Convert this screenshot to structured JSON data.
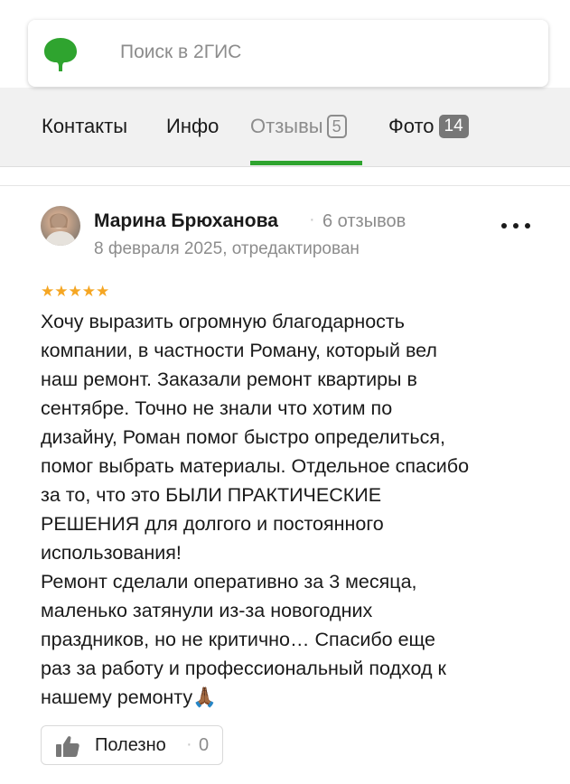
{
  "search": {
    "placeholder": "Поиск в 2ГИС",
    "logo_icon": "2gis-leaf-logo",
    "logo_color": "#2fa42f"
  },
  "tabs": [
    {
      "label": "Контакты",
      "active": false
    },
    {
      "label": "Инфо",
      "active": false
    },
    {
      "label": "Отзывы",
      "badge": "5",
      "active": true
    },
    {
      "label": "Фото",
      "badge": "14",
      "active": false
    }
  ],
  "accent_color": "#2fa42f",
  "review": {
    "author": "Марина Брюханова",
    "separator": "·",
    "author_review_count": "6 отзывов",
    "date": "8 февраля 2025, отредактирован",
    "rating": 5,
    "stars": "★★★★★",
    "text": "Хочу выразить огромную благодарность\nкомпании, в частности Роману, который вел\nнаш ремонт. Заказали ремонт квартиры в\nсентябре. Точно не знали что хотим по\nдизайну, Роман помог быстро определиться,\nпомог выбрать материалы. Отдельное спасибо\nза то, что это БЫЛИ ПРАКТИЧЕСКИЕ\nРЕШЕНИЯ для долгого и постоянного\nиспользования!\nРемонт сделали оперативно за 3 месяца,\nмаленько затянули из-за новогодних\nпраздников, но не критично… Спасибо еще\nраз за работу и профессиональный подход к\nнашему ремонту🙏🏾",
    "helpful_label": "Полезно",
    "helpful_separator": "·",
    "helpful_count": "0"
  }
}
